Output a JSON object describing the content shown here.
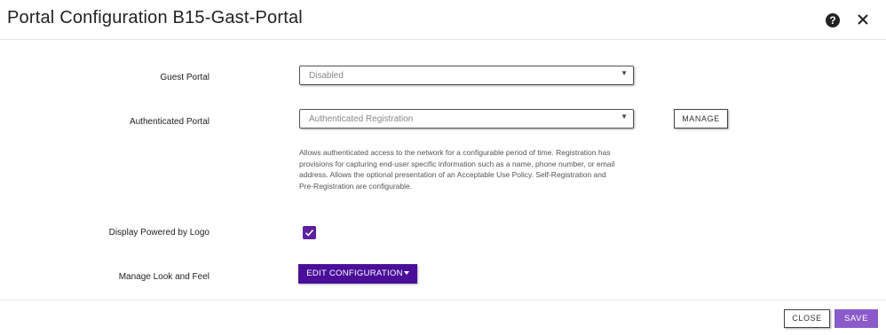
{
  "dialog": {
    "title": "Portal Configuration B15-Gast-Portal",
    "help_icon": "?",
    "close_icon": "close-icon"
  },
  "form": {
    "guest_portal": {
      "label": "Guest Portal",
      "value": "Disabled"
    },
    "authenticated_portal": {
      "label": "Authenticated Portal",
      "value": "Authenticated Registration",
      "manage_label": "MANAGE",
      "description": "Allows authenticated access to the network for a configurable period of time. Registration has provisions for capturing end-user specific information such as a name, phone number, or email address. Allows the optional presentation of an Acceptable Use Policy. Self-Registration and Pre-Registration are configurable."
    },
    "display_logo": {
      "label": "Display Powered by Logo",
      "checked": true
    },
    "look_and_feel": {
      "label": "Manage Look and Feel",
      "button_label": "EDIT CONFIGURATION"
    }
  },
  "footer": {
    "close_label": "CLOSE",
    "save_label": "SAVE"
  },
  "colors": {
    "accent": "#4a0f9a",
    "checkbox": "#5b1fa0",
    "save": "#8a5bc9"
  }
}
